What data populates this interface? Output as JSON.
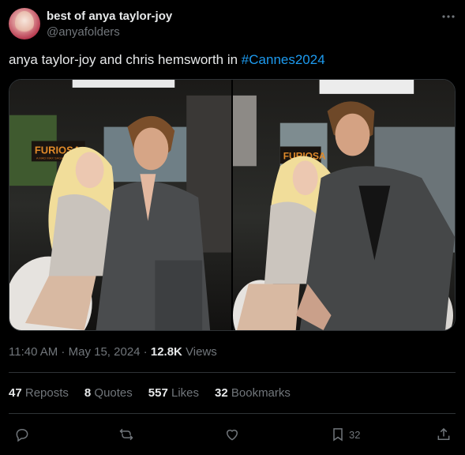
{
  "author": {
    "display_name": "best of anya taylor-joy",
    "handle": "@anyafolders"
  },
  "tweet": {
    "text_before": "anya taylor-joy and chris hemsworth in ",
    "hashtag": "#Cannes2024"
  },
  "media": {
    "photos": [
      {
        "poster_text": "FURIOSA",
        "poster_subtext": "A MAD MAX SAGA"
      },
      {
        "poster_text": "FURIOSA"
      }
    ]
  },
  "meta": {
    "time": "11:40 AM",
    "date": "May 15, 2024",
    "views_count": "12.8K",
    "views_label": "Views"
  },
  "stats": [
    {
      "count": "47",
      "label": "Reposts"
    },
    {
      "count": "8",
      "label": "Quotes"
    },
    {
      "count": "557",
      "label": "Likes"
    },
    {
      "count": "32",
      "label": "Bookmarks"
    }
  ],
  "actions": {
    "bookmark_count": "32"
  },
  "icons": [
    "more-icon",
    "reply-icon",
    "repost-icon",
    "like-icon",
    "bookmark-icon",
    "share-icon"
  ],
  "colors": {
    "background": "#000000",
    "text": "#e7e9ea",
    "muted": "#71767b",
    "link": "#1d9bf0",
    "border": "#2f3336"
  }
}
